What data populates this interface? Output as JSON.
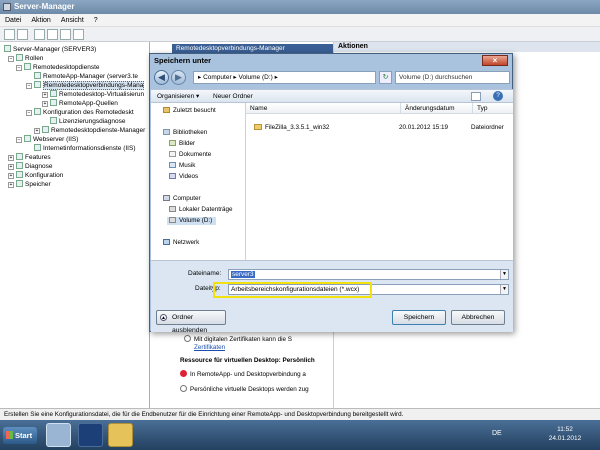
{
  "window": {
    "title": "Server-Manager"
  },
  "menu": [
    "Datei",
    "Aktion",
    "Ansicht",
    "?"
  ],
  "tree": {
    "items": [
      "Server-Manager (SERVER3)",
      "Rollen",
      "Remotedesktopdienste",
      "RemoteApp-Manager (server3.te",
      "Remotedesktopverbindungs-Mana",
      "Remotedesktop-Virtualisierun",
      "RemoteApp-Quellen",
      "Konfiguration des Remotedeskt",
      "Lizenzierungsdiagnose",
      "Remotedesktopdienste-Manager",
      "Webserver (IIS)",
      "Internetinformationsdienste (IIS)",
      "Features",
      "Diagnose",
      "Konfiguration",
      "Speicher"
    ]
  },
  "behind": {
    "mid_header": "Remotedesktopverbindungs-Manager",
    "right_header": "Aktionen",
    "lower": {
      "line1": "Mit digitalen Zertifikaten kann die S",
      "line2": "Zertifikaten",
      "section": "Ressource für virtuellen Desktop: Persönlich",
      "item1": "In RemoteApp- und Desktopverbindung a",
      "item2": "Persönliche virtuelle Desktops werden zug"
    }
  },
  "dialog": {
    "title": "Speichern unter",
    "address": "▸ Computer ▸ Volume (D:) ▸",
    "search_placeholder": "Volume (D:) durchsuchen",
    "toolbar": {
      "organize": "Organisieren ▾",
      "new_folder": "Neuer Ordner"
    },
    "nav": {
      "recent": "Zuletzt besucht",
      "libraries": "Bibliotheken",
      "pictures": "Bilder",
      "documents": "Dokumente",
      "music": "Musik",
      "videos": "Videos",
      "computer": "Computer",
      "local_disk": "Lokaler Datenträge",
      "volume": "Volume (D:)",
      "network": "Netzwerk"
    },
    "columns": {
      "name": "Name",
      "date": "Änderungsdatum",
      "type": "Typ"
    },
    "files": [
      {
        "name": "FileZilla_3.3.5.1_win32",
        "date": "20.01.2012 15:19",
        "type": "Dateiordner"
      }
    ],
    "filename_label": "Dateiname:",
    "filename_value": "server3",
    "filetype_label": "Dateityp:",
    "filetype_value": "Arbeitsbereichskonfigurationsdateien (*.wcx)",
    "hide_folders": "Ordner ausblenden",
    "save": "Speichern",
    "cancel": "Abbrechen"
  },
  "status": "Erstellen Sie eine Konfigurationsdatei, die für die Endbenutzer für die Einrichtung einer RemoteApp- und Desktopverbindung bereitgestellt wird.",
  "taskbar": {
    "start": "Start",
    "lang": "DE",
    "time": "11:52",
    "date": "24.01.2012"
  },
  "colors": {
    "highlight": "#f1e10e",
    "dialog_frame": "#a9c2dd",
    "taskbar": "#2c4d72"
  }
}
